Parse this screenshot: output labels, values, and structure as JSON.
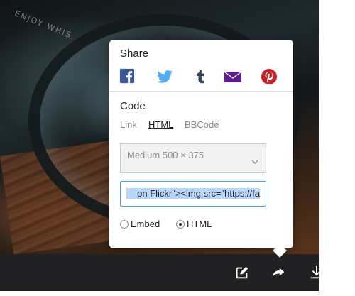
{
  "photo": {
    "etched_text": "ENJOY WHIS"
  },
  "share": {
    "title": "Share",
    "icons": [
      {
        "name": "facebook-icon",
        "color": "#3b5998"
      },
      {
        "name": "twitter-icon",
        "color": "#55acee"
      },
      {
        "name": "tumblr-icon",
        "color": "#35465c"
      },
      {
        "name": "email-icon",
        "color": "#5f1c8f"
      },
      {
        "name": "pinterest-icon",
        "color": "#cb2027"
      }
    ]
  },
  "code": {
    "title": "Code",
    "tabs": [
      {
        "label": "Link",
        "active": false
      },
      {
        "label": "HTML",
        "active": true
      },
      {
        "label": "BBCode",
        "active": false
      }
    ],
    "size_select": {
      "value": "Medium 500 × 375"
    },
    "code_value": "on Flickr\"><img src=\"https://fa",
    "embed_options": [
      {
        "label": "Embed",
        "selected": false
      },
      {
        "label": "HTML",
        "selected": true
      }
    ]
  },
  "toolbar": {
    "buttons": [
      {
        "name": "edit-icon"
      },
      {
        "name": "share-icon"
      },
      {
        "name": "download-icon"
      }
    ]
  }
}
